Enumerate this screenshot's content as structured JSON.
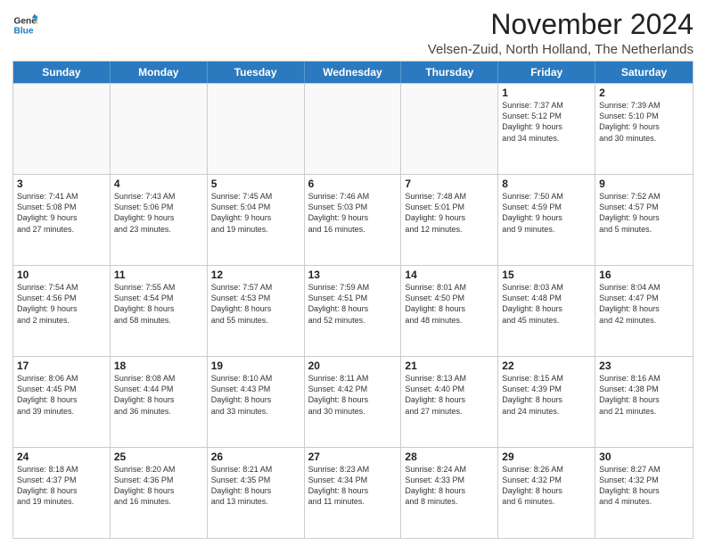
{
  "logo": {
    "line1": "General",
    "line2": "Blue"
  },
  "title": "November 2024",
  "location": "Velsen-Zuid, North Holland, The Netherlands",
  "header_days": [
    "Sunday",
    "Monday",
    "Tuesday",
    "Wednesday",
    "Thursday",
    "Friday",
    "Saturday"
  ],
  "rows": [
    [
      {
        "day": "",
        "info": ""
      },
      {
        "day": "",
        "info": ""
      },
      {
        "day": "",
        "info": ""
      },
      {
        "day": "",
        "info": ""
      },
      {
        "day": "",
        "info": ""
      },
      {
        "day": "1",
        "info": "Sunrise: 7:37 AM\nSunset: 5:12 PM\nDaylight: 9 hours\nand 34 minutes."
      },
      {
        "day": "2",
        "info": "Sunrise: 7:39 AM\nSunset: 5:10 PM\nDaylight: 9 hours\nand 30 minutes."
      }
    ],
    [
      {
        "day": "3",
        "info": "Sunrise: 7:41 AM\nSunset: 5:08 PM\nDaylight: 9 hours\nand 27 minutes."
      },
      {
        "day": "4",
        "info": "Sunrise: 7:43 AM\nSunset: 5:06 PM\nDaylight: 9 hours\nand 23 minutes."
      },
      {
        "day": "5",
        "info": "Sunrise: 7:45 AM\nSunset: 5:04 PM\nDaylight: 9 hours\nand 19 minutes."
      },
      {
        "day": "6",
        "info": "Sunrise: 7:46 AM\nSunset: 5:03 PM\nDaylight: 9 hours\nand 16 minutes."
      },
      {
        "day": "7",
        "info": "Sunrise: 7:48 AM\nSunset: 5:01 PM\nDaylight: 9 hours\nand 12 minutes."
      },
      {
        "day": "8",
        "info": "Sunrise: 7:50 AM\nSunset: 4:59 PM\nDaylight: 9 hours\nand 9 minutes."
      },
      {
        "day": "9",
        "info": "Sunrise: 7:52 AM\nSunset: 4:57 PM\nDaylight: 9 hours\nand 5 minutes."
      }
    ],
    [
      {
        "day": "10",
        "info": "Sunrise: 7:54 AM\nSunset: 4:56 PM\nDaylight: 9 hours\nand 2 minutes."
      },
      {
        "day": "11",
        "info": "Sunrise: 7:55 AM\nSunset: 4:54 PM\nDaylight: 8 hours\nand 58 minutes."
      },
      {
        "day": "12",
        "info": "Sunrise: 7:57 AM\nSunset: 4:53 PM\nDaylight: 8 hours\nand 55 minutes."
      },
      {
        "day": "13",
        "info": "Sunrise: 7:59 AM\nSunset: 4:51 PM\nDaylight: 8 hours\nand 52 minutes."
      },
      {
        "day": "14",
        "info": "Sunrise: 8:01 AM\nSunset: 4:50 PM\nDaylight: 8 hours\nand 48 minutes."
      },
      {
        "day": "15",
        "info": "Sunrise: 8:03 AM\nSunset: 4:48 PM\nDaylight: 8 hours\nand 45 minutes."
      },
      {
        "day": "16",
        "info": "Sunrise: 8:04 AM\nSunset: 4:47 PM\nDaylight: 8 hours\nand 42 minutes."
      }
    ],
    [
      {
        "day": "17",
        "info": "Sunrise: 8:06 AM\nSunset: 4:45 PM\nDaylight: 8 hours\nand 39 minutes."
      },
      {
        "day": "18",
        "info": "Sunrise: 8:08 AM\nSunset: 4:44 PM\nDaylight: 8 hours\nand 36 minutes."
      },
      {
        "day": "19",
        "info": "Sunrise: 8:10 AM\nSunset: 4:43 PM\nDaylight: 8 hours\nand 33 minutes."
      },
      {
        "day": "20",
        "info": "Sunrise: 8:11 AM\nSunset: 4:42 PM\nDaylight: 8 hours\nand 30 minutes."
      },
      {
        "day": "21",
        "info": "Sunrise: 8:13 AM\nSunset: 4:40 PM\nDaylight: 8 hours\nand 27 minutes."
      },
      {
        "day": "22",
        "info": "Sunrise: 8:15 AM\nSunset: 4:39 PM\nDaylight: 8 hours\nand 24 minutes."
      },
      {
        "day": "23",
        "info": "Sunrise: 8:16 AM\nSunset: 4:38 PM\nDaylight: 8 hours\nand 21 minutes."
      }
    ],
    [
      {
        "day": "24",
        "info": "Sunrise: 8:18 AM\nSunset: 4:37 PM\nDaylight: 8 hours\nand 19 minutes."
      },
      {
        "day": "25",
        "info": "Sunrise: 8:20 AM\nSunset: 4:36 PM\nDaylight: 8 hours\nand 16 minutes."
      },
      {
        "day": "26",
        "info": "Sunrise: 8:21 AM\nSunset: 4:35 PM\nDaylight: 8 hours\nand 13 minutes."
      },
      {
        "day": "27",
        "info": "Sunrise: 8:23 AM\nSunset: 4:34 PM\nDaylight: 8 hours\nand 11 minutes."
      },
      {
        "day": "28",
        "info": "Sunrise: 8:24 AM\nSunset: 4:33 PM\nDaylight: 8 hours\nand 8 minutes."
      },
      {
        "day": "29",
        "info": "Sunrise: 8:26 AM\nSunset: 4:32 PM\nDaylight: 8 hours\nand 6 minutes."
      },
      {
        "day": "30",
        "info": "Sunrise: 8:27 AM\nSunset: 4:32 PM\nDaylight: 8 hours\nand 4 minutes."
      }
    ]
  ]
}
